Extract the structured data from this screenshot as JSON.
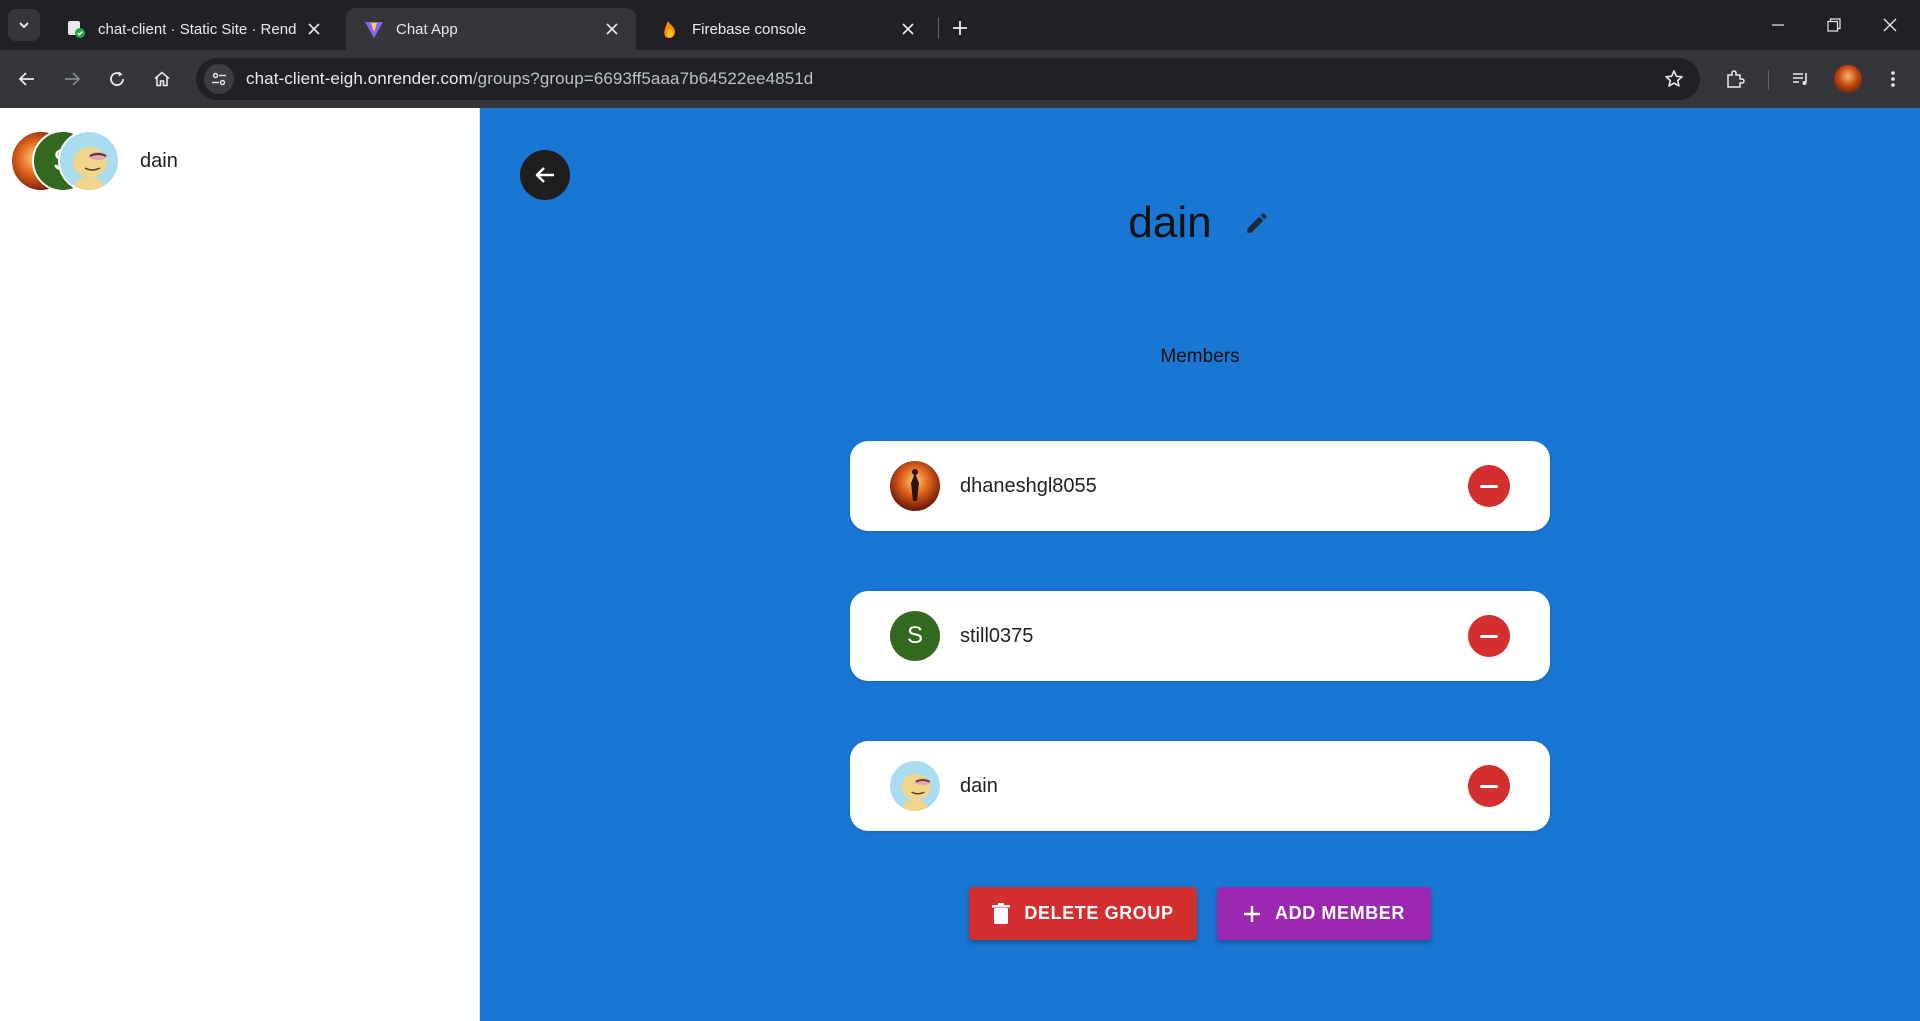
{
  "browser": {
    "tabs": [
      {
        "title": "chat-client · Static Site · Render",
        "favicon": "render-icon",
        "active": false
      },
      {
        "title": "Chat App",
        "favicon": "vite-icon",
        "active": true
      },
      {
        "title": "Firebase console",
        "favicon": "firebase-icon",
        "active": false
      }
    ],
    "url_host": "chat-client-eigh.onrender.com",
    "url_path": "/groups?group=6693ff5aaa7b64522ee4851d"
  },
  "sidebar": {
    "groups": [
      {
        "name": "dain",
        "member_avatars": [
          "photo-avatar",
          "S",
          "cartoon-avatar"
        ]
      }
    ]
  },
  "main": {
    "group_name": "dain",
    "members_heading": "Members",
    "members": [
      {
        "username": "dhaneshgl8055",
        "avatar": "photo-avatar"
      },
      {
        "username": "still0375",
        "avatar": "S",
        "avatar_color": "#33691e"
      },
      {
        "username": "dain",
        "avatar": "cartoon-avatar"
      }
    ],
    "delete_label": "DELETE GROUP",
    "add_label": "ADD MEMBER"
  },
  "colors": {
    "main_bg": "#1976d2",
    "delete": "#d32f2f",
    "add": "#9c27b0",
    "remove": "#d32f2f"
  }
}
